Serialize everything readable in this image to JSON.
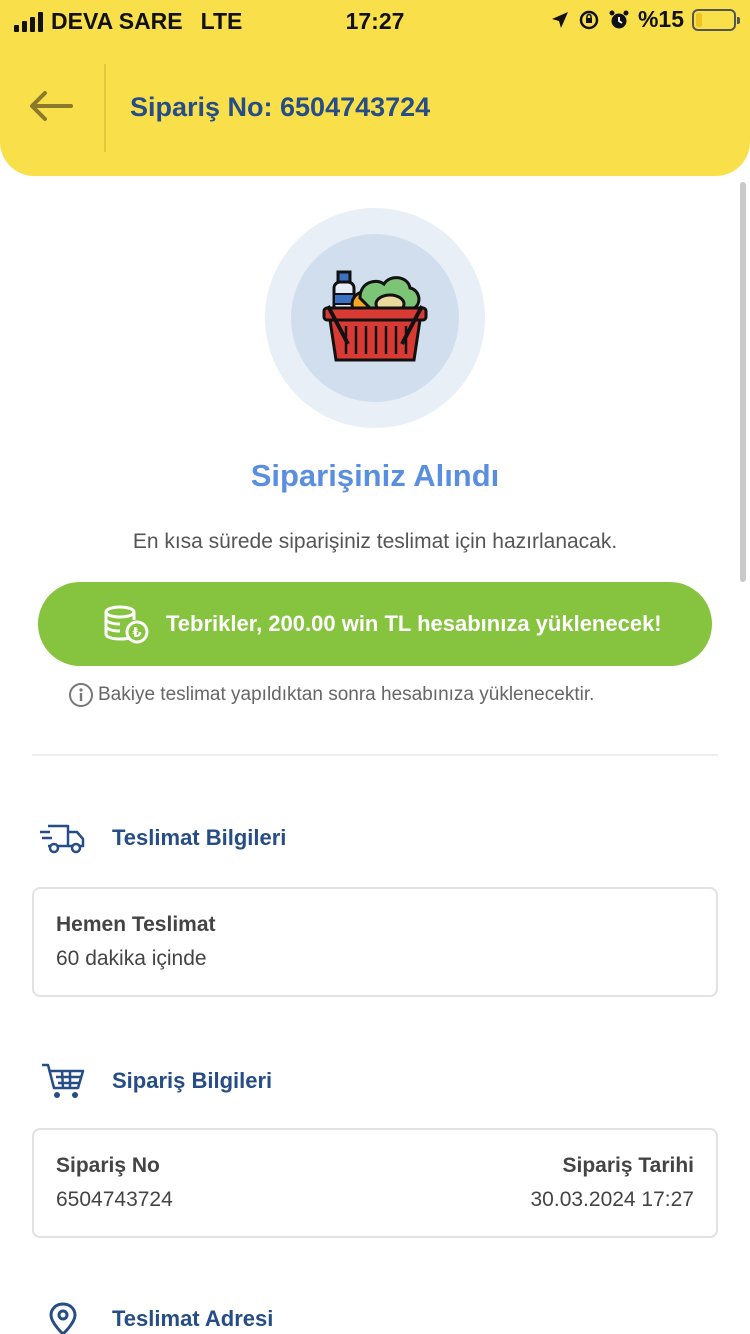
{
  "status_bar": {
    "carrier": "DEVA SARE",
    "network": "LTE",
    "time": "17:27",
    "battery": "%15"
  },
  "header": {
    "back_icon": "arrow-left-icon",
    "title": "Sipariş No: 6504743724"
  },
  "hero": {
    "icon": "grocery-basket-icon",
    "title": "Siparişiniz Alındı",
    "subtitle": "En kısa sürede siparişiniz teslimat için hazırlanacak."
  },
  "reward": {
    "icon": "coins-icon",
    "text": "Tebrikler, 200.00 win TL hesabınıza yüklenecek!",
    "note": "Bakiye teslimat yapıldıktan sonra hesabınıza yüklenecektir."
  },
  "delivery": {
    "section_title": "Teslimat Bilgileri",
    "icon": "truck-icon",
    "type": "Hemen Teslimat",
    "eta": "60 dakika içinde"
  },
  "order": {
    "section_title": "Sipariş Bilgileri",
    "icon": "cart-icon",
    "no_label": "Sipariş No",
    "no_value": "6504743724",
    "date_label": "Sipariş Tarihi",
    "date_value": "30.03.2024 17:27"
  },
  "address": {
    "section_title": "Teslimat Adresi",
    "icon": "location-pin-icon"
  },
  "colors": {
    "header_bg": "#f9e04b",
    "primary_text": "#264d86",
    "accent_blue": "#5a8fe0",
    "reward_green": "#86c43f"
  }
}
